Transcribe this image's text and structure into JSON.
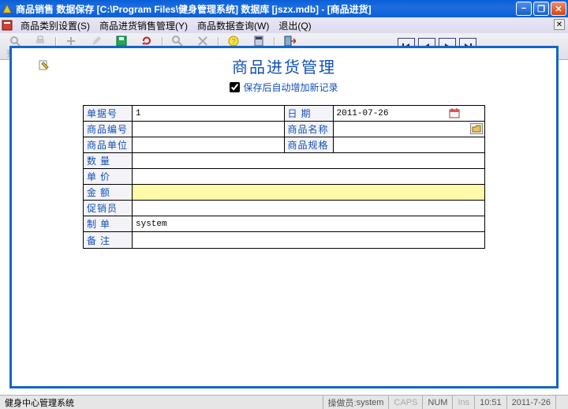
{
  "window": {
    "title": "商品销售 数据保存 [C:\\Program Files\\健身管理系统] 数据库 [jszx.mdb] - [商品进货]"
  },
  "menus": {
    "cat": "商品类别设置(S)",
    "sales": "商品进货销售管理(Y)",
    "query": "商品数据查询(W)",
    "exit": "退出(Q)"
  },
  "toolbar": {
    "preview": "预览",
    "print": "打印",
    "add": "增加",
    "edit": "修改",
    "save": "保存",
    "cancel": "撤消",
    "find": "查询",
    "delete": "删除",
    "help": "帮助",
    "calc": "计算",
    "exit": "退出"
  },
  "page": {
    "title": "商品进货管理",
    "autoadd_label": "保存后自动增加新记录"
  },
  "form": {
    "labels": {
      "billno": "单据号",
      "date": "日  期",
      "prodno": "商品编号",
      "prodname": "商品名称",
      "unit": "商品单位",
      "spec": "商品规格",
      "qty": "数  量",
      "price": "单  价",
      "amount": "金  额",
      "promoter": "促销员",
      "maker": "制  单",
      "remark": "备  注"
    },
    "values": {
      "billno": "1",
      "date": "2011-07-26",
      "prodno": "",
      "prodname": "",
      "unit": "",
      "spec": "",
      "qty": "",
      "price": "",
      "amount": "",
      "promoter": "",
      "maker": "system",
      "remark": ""
    }
  },
  "status": {
    "app": "健身中心管理系统",
    "operator_label": "操做员:",
    "operator": "system",
    "caps": "CAPS",
    "num": "NUM",
    "ins": "Ins",
    "time": "10:51",
    "date": "2011-7-26"
  }
}
